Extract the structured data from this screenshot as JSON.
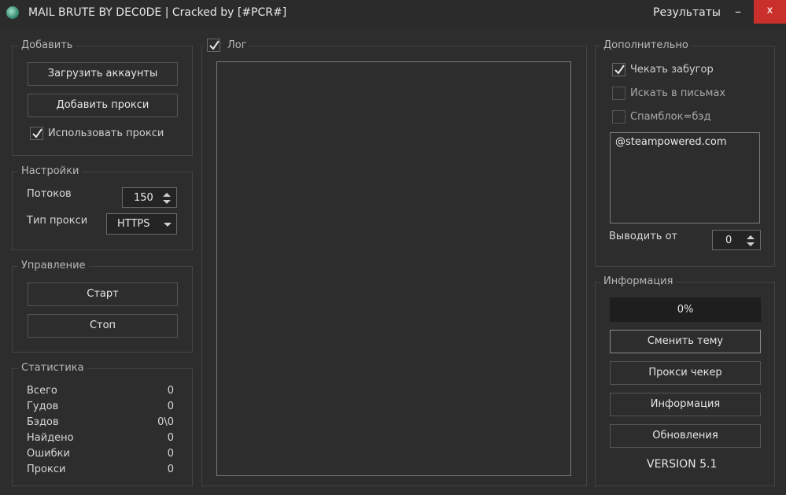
{
  "window": {
    "title": "MAIL BRUTE BY DEC0DE | Cracked by [#PCR#]",
    "results_label": "Результаты",
    "minimize_label": "–",
    "close_label": "x"
  },
  "add_group": {
    "legend": "Добавить",
    "load_accounts": "Загрузить аккаунты",
    "add_proxy": "Добавить прокси",
    "use_proxy": {
      "label": "Использовать прокси",
      "checked": true
    }
  },
  "settings_group": {
    "legend": "Настройки",
    "threads_label": "Потоков",
    "threads_value": "150",
    "proxy_type_label": "Тип прокси",
    "proxy_type_value": "HTTPS"
  },
  "control_group": {
    "legend": "Управление",
    "start": "Старт",
    "stop": "Стоп"
  },
  "stats_group": {
    "legend": "Статистика",
    "rows": [
      {
        "label": "Всего",
        "value": "0"
      },
      {
        "label": "Гудов",
        "value": "0"
      },
      {
        "label": "Бэдов",
        "value": "0\\0"
      },
      {
        "label": "Найдено",
        "value": "0"
      },
      {
        "label": "Ошибки",
        "value": "0"
      },
      {
        "label": "Прокси",
        "value": "0"
      }
    ]
  },
  "log_group": {
    "legend": "Лог",
    "checked": true
  },
  "extra_group": {
    "legend": "Дополнительно",
    "check_forum": {
      "label": "Чекать забугор",
      "checked": true
    },
    "search_mail": {
      "label": "Искать в письмах",
      "checked": false
    },
    "spamblock": {
      "label": "Спамблок=бэд",
      "checked": false
    },
    "mail_list": [
      "@steampowered.com"
    ],
    "output_from_label": "Выводить от",
    "output_from_value": "0"
  },
  "info_group": {
    "legend": "Информация",
    "progress_text": "0%",
    "progress_value": 0,
    "change_theme": "Сменить тему",
    "proxy_checker": "Прокси чекер",
    "info": "Информация",
    "updates": "Обновления",
    "version": "VERSION 5.1"
  },
  "colors": {
    "background": "#2d2d2d",
    "close_button": "#c9302c",
    "text": "#dcdcdc"
  }
}
